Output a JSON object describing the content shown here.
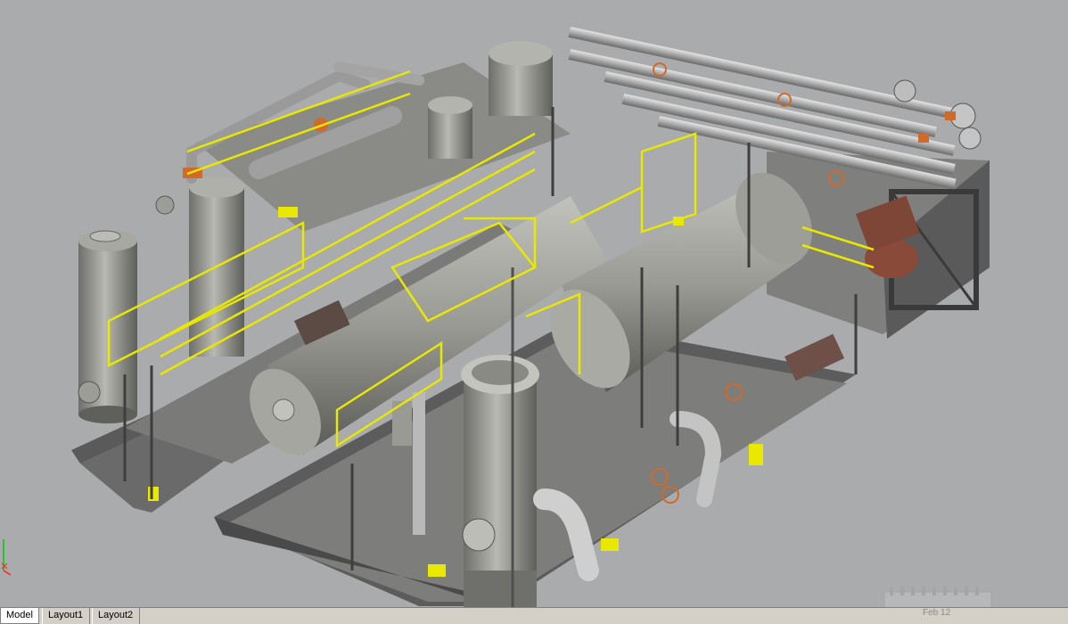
{
  "viewport": {
    "background_color": "#a9abad",
    "equipment_color": "#8e8e88",
    "handrail_color": "#e8e800",
    "valve_color": "#d06a2a",
    "pump_color": "#8a4a3a"
  },
  "layout_tabs": [
    {
      "label": "Model",
      "active": true
    },
    {
      "label": "Layout1",
      "active": false
    },
    {
      "label": "Layout2",
      "active": false
    }
  ],
  "watermark": {
    "text": "Feb 12"
  },
  "ucs_icon": "ucs-axis-icon"
}
